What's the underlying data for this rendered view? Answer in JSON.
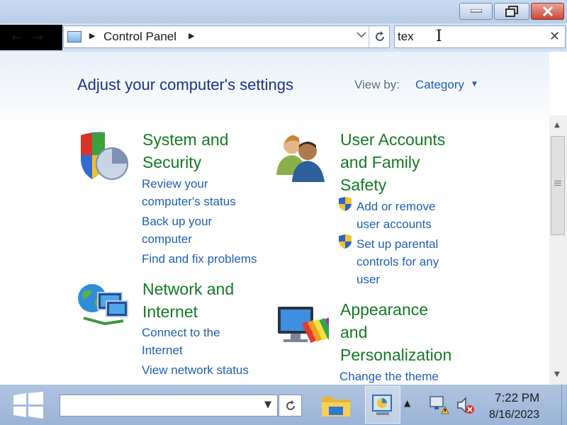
{
  "window": {
    "minimize_glyph": "▁",
    "restore_glyph": "❐",
    "close_glyph": "✕"
  },
  "nav": {
    "breadcrumb": "Control Panel",
    "search_value": "tex"
  },
  "content": {
    "page_title": "Adjust your computer's settings",
    "view_by_label": "View by:",
    "view_by_value": "Category",
    "categories": [
      {
        "title_lines": [
          "System and",
          "Security"
        ],
        "icon": "shield-icon",
        "links": [
          {
            "lines": [
              "Review your",
              "computer's status"
            ]
          },
          {
            "lines": [
              "Back up your",
              "computer"
            ]
          },
          {
            "lines": [
              "Find and fix problems"
            ]
          }
        ]
      },
      {
        "title_lines": [
          "User Accounts",
          "and Family",
          "Safety"
        ],
        "icon": "users-icon",
        "links": [
          {
            "lines": [
              "Add or remove",
              "user accounts"
            ],
            "uac_shield": true
          },
          {
            "lines": [
              "Set up parental",
              "controls for any",
              "user"
            ],
            "uac_shield": true
          }
        ]
      },
      {
        "title_lines": [
          "Network and",
          "Internet"
        ],
        "icon": "network-globe-icon",
        "links": [
          {
            "lines": [
              "Connect to the",
              "Internet"
            ]
          },
          {
            "lines": [
              "View network status"
            ]
          }
        ]
      },
      {
        "title_lines": [
          "Appearance",
          "and",
          "Personalization"
        ],
        "icon": "monitor-palette-icon",
        "links": [
          {
            "lines": [
              "Change the theme"
            ]
          }
        ]
      }
    ]
  },
  "taskbar": {
    "time": "7:22 PM",
    "date": "8/16/2023",
    "address_value": ""
  },
  "colors": {
    "category_title": "#137a22",
    "link": "#1f5fb5",
    "page_title": "#1e3287"
  }
}
